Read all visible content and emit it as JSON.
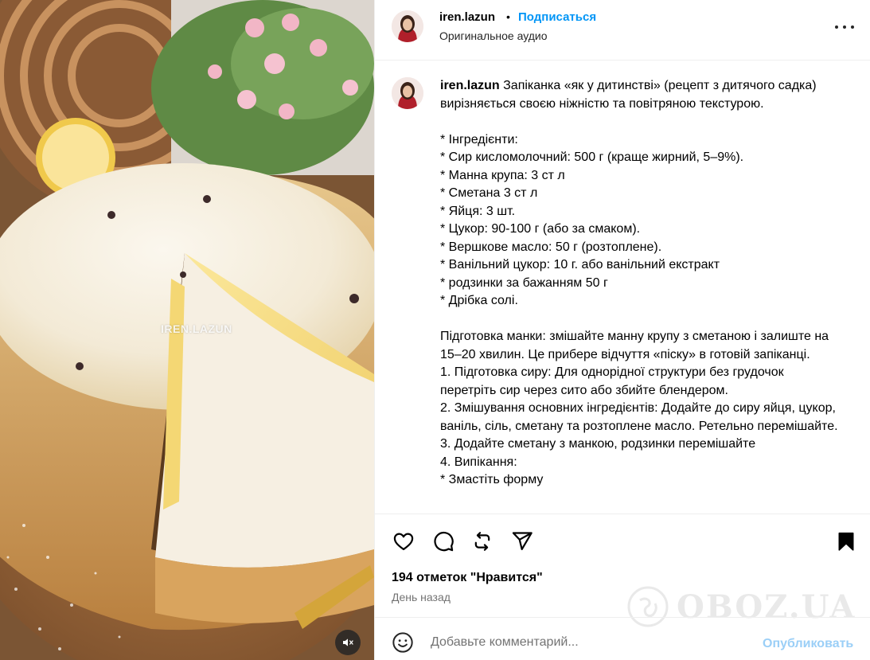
{
  "post": {
    "username": "iren.lazun",
    "follow_label": "Подписаться",
    "separator": "•",
    "audio": "Оригинальное аудио",
    "more_icon": "more-horizontal-icon"
  },
  "media": {
    "watermark": "IREN.LAZUN",
    "mute_icon": "speaker-muted-icon"
  },
  "caption": {
    "username": "iren.lazun",
    "first_line_text": " Запіканка «як у дитинстві» (рецепт з дитячого садка) вирізняється своєю ніжністю та повітряною текстурою.",
    "lines": [
      "",
      "* Інгредієнти:",
      "* Сир кисломолочний: 500 г (краще жирний, 5–9%).",
      "* Манна крупа: 3 ст л",
      "* Сметана 3 ст л",
      "* Яйця: 3 шт.",
      "* Цукор: 90-100 г (або за смаком).",
      "* Вершкове масло: 50 г (розтоплене).",
      "* Ванільний цукор: 10 г. або ванільний екстракт",
      "* родзинки за бажанням 50 г",
      "* Дрібка солі.",
      "",
      "Підготовка манки: змішайте манну крупу з сметаною і залиште на 15–20 хвилин. Це прибере відчуття «піску» в готовій запіканці.",
      "1. Підготовка сиру: Для однорідної структури без грудочок перетріть сир через сито або збийте блендером.",
      "2. Змішування основних інгредієнтів: Додайте до сиру яйця, цукор, ваніль, сіль, сметану та розтоплене масло. Ретельно перемішайте.",
      "3. Додайте сметану з манкою, родзинки перемішайте",
      "4. Випікання:",
      "* Змастіть форму"
    ]
  },
  "actions": {
    "like_icon": "heart-icon",
    "comment_icon": "comment-icon",
    "repost_icon": "repost-icon",
    "share_icon": "send-icon",
    "save_icon": "bookmark-filled-icon",
    "likes_text": "194 отметок \"Нравится\"",
    "time_text": "День назад"
  },
  "watermark_logo": {
    "text": "OBOZ.UA"
  },
  "comment_bar": {
    "emoji_icon": "emoji-icon",
    "placeholder": "Добавьте комментарий...",
    "publish_label": "Опубликовать"
  },
  "colors": {
    "link_blue": "#0095f6",
    "publish_disabled": "#9bcff7",
    "divider": "#efefef",
    "secondary_text": "#737373"
  }
}
